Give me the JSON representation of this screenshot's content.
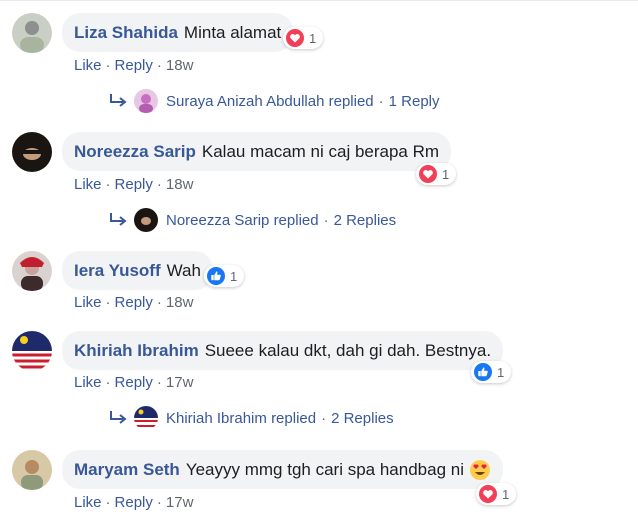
{
  "colors": {
    "link": "#385898",
    "muted": "#606770",
    "bubble": "#f2f3f5",
    "love": "#f33e58",
    "like": "#1877f2"
  },
  "comments": [
    {
      "author": "Liza Shahida",
      "text": "Minta alamat",
      "reaction_icon": "love-icon",
      "reaction_count": "1",
      "actions": {
        "like": "Like",
        "reply": "Reply",
        "time": "18w"
      },
      "replies": {
        "author": "Suraya Anizah Abdullah",
        "verb": "replied",
        "count": "1 Reply"
      }
    },
    {
      "author": "Noreezza Sarip",
      "text": "Kalau macam ni caj berapa Rm",
      "reaction_icon": "love-icon",
      "reaction_count": "1",
      "actions": {
        "like": "Like",
        "reply": "Reply",
        "time": "18w"
      },
      "replies": {
        "author": "Noreezza Sarip",
        "verb": "replied",
        "count": "2 Replies"
      }
    },
    {
      "author": "Iera Yusoff",
      "text": "Wah",
      "reaction_icon": "like-icon",
      "reaction_count": "1",
      "actions": {
        "like": "Like",
        "reply": "Reply",
        "time": "18w"
      }
    },
    {
      "author": "Khiriah Ibrahim",
      "text": "Sueee kalau dkt, dah gi dah. Bestnya.",
      "reaction_icon": "like-icon",
      "reaction_count": "1",
      "actions": {
        "like": "Like",
        "reply": "Reply",
        "time": "17w"
      },
      "replies": {
        "author": "Khiriah Ibrahim",
        "verb": "replied",
        "count": "2 Replies"
      }
    },
    {
      "author": "Maryam Seth",
      "text": "Yeayyy mmg tgh cari spa handbag ni",
      "emoji": "heart-eyes-emoji-icon",
      "reaction_icon": "love-icon",
      "reaction_count": "1",
      "actions": {
        "like": "Like",
        "reply": "Reply",
        "time": "17w"
      }
    }
  ]
}
